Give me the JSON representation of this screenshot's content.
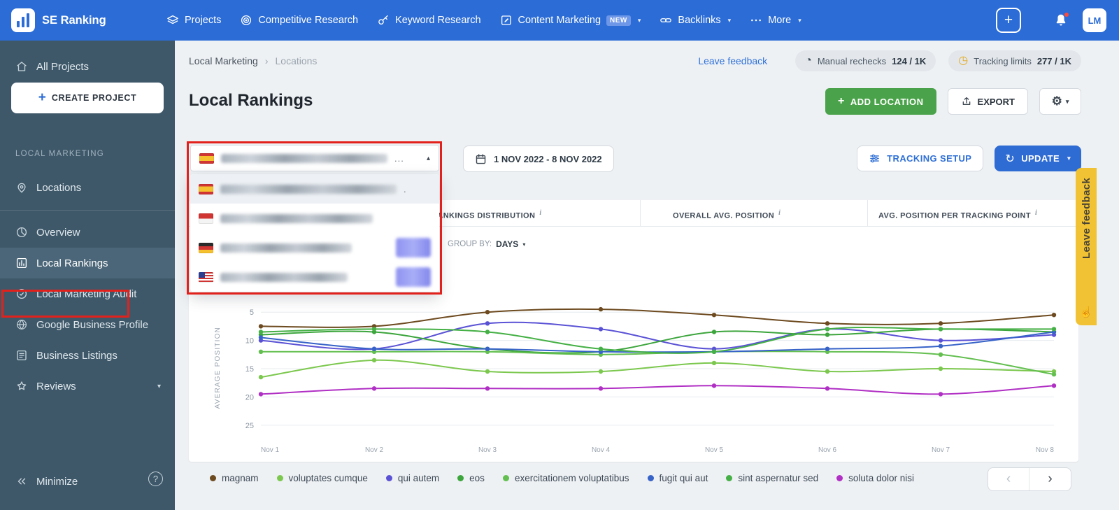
{
  "topbar": {
    "brand": "SE Ranking",
    "nav": [
      {
        "label": "Projects"
      },
      {
        "label": "Competitive Research"
      },
      {
        "label": "Keyword Research"
      },
      {
        "label": "Content Marketing",
        "badge": "NEW"
      },
      {
        "label": "Backlinks"
      },
      {
        "label": "More"
      }
    ],
    "avatar": "LM"
  },
  "sidebar": {
    "all_projects": "All Projects",
    "create_project": "CREATE PROJECT",
    "section": "LOCAL MARKETING",
    "locations": "Locations",
    "menu": [
      "Overview",
      "Local Rankings",
      "Local Marketing Audit",
      "Google Business Profile",
      "Business Listings",
      "Reviews"
    ],
    "minimize": "Minimize",
    "help": "?"
  },
  "header": {
    "breadcrumb": [
      "Local Marketing",
      "Locations"
    ],
    "leave_feedback": "Leave feedback",
    "manual_rechecks_label": "Manual rechecks",
    "manual_rechecks_value": "124 / 1K",
    "tracking_limits_label": "Tracking limits",
    "tracking_limits_value": "277 / 1K"
  },
  "page": {
    "title": "Local Rankings",
    "add_location": "ADD LOCATION",
    "export": "EXPORT"
  },
  "controls": {
    "date_range": "1 NOV 2022 - 8 NOV 2022",
    "tracking_setup": "TRACKING SETUP",
    "update": "UPDATE"
  },
  "tabs": [
    {
      "label": "RANKINGS DISTRIBUTION"
    },
    {
      "label": "OVERALL AVG. POSITION"
    },
    {
      "label": "AVG. POSITION PER TRACKING POINT"
    }
  ],
  "group_by": {
    "label": "GROUP BY:",
    "value": "DAYS"
  },
  "dropdown": {
    "ellipsis": "...",
    "items": [
      {
        "flag": "es",
        "selected": true
      },
      {
        "flag": "id"
      },
      {
        "flag": "de",
        "badge": true
      },
      {
        "flag": "us",
        "badge": true
      }
    ]
  },
  "chart_data": {
    "type": "line",
    "x": [
      "Nov 1",
      "Nov 2",
      "Nov 3",
      "Nov 4",
      "Nov 5",
      "Nov 6",
      "Nov 7",
      "Nov 8"
    ],
    "ylabel": "AVERAGE POSITION",
    "yticks": [
      5,
      10,
      15,
      20,
      25
    ],
    "ylim": [
      3,
      27
    ],
    "y_axis_inverted": true,
    "grid": true,
    "legend_position": "bottom",
    "series": [
      {
        "name": "magnam",
        "color": "#6d4a1f",
        "values": [
          7.5,
          7.5,
          5,
          4.5,
          5.5,
          7,
          7,
          5.5
        ]
      },
      {
        "name": "voluptates cumque",
        "color": "#7cc84e",
        "values": [
          16.5,
          13.5,
          15.5,
          15.5,
          14,
          15.5,
          15,
          15.5
        ]
      },
      {
        "name": "qui autem",
        "color": "#5a52d5",
        "values": [
          10,
          11.5,
          7,
          8,
          11.5,
          8,
          10,
          9
        ]
      },
      {
        "name": "eos",
        "color": "#3ca53c",
        "values": [
          9,
          8.5,
          11.5,
          12,
          8.5,
          9,
          8,
          8.5
        ]
      },
      {
        "name": "exercitationem voluptatibus",
        "color": "#63bf4f",
        "values": [
          12,
          12,
          12,
          12.5,
          12,
          12,
          12.5,
          16
        ]
      },
      {
        "name": "fugit qui aut",
        "color": "#3763c8",
        "values": [
          9.5,
          11.5,
          11.5,
          12,
          12,
          11.5,
          11,
          8.5
        ]
      },
      {
        "name": "sint aspernatur sed",
        "color": "#45b045",
        "values": [
          8.5,
          8,
          8.5,
          11.5,
          12,
          8,
          8,
          8
        ]
      },
      {
        "name": "soluta dolor nisi",
        "color": "#b02fc4",
        "values": [
          19.5,
          18.5,
          18.5,
          18.5,
          18,
          18.5,
          19.5,
          18
        ]
      }
    ]
  },
  "feedback_tab": "Leave feedback",
  "pagination": {
    "prev": "‹",
    "next": "›"
  }
}
